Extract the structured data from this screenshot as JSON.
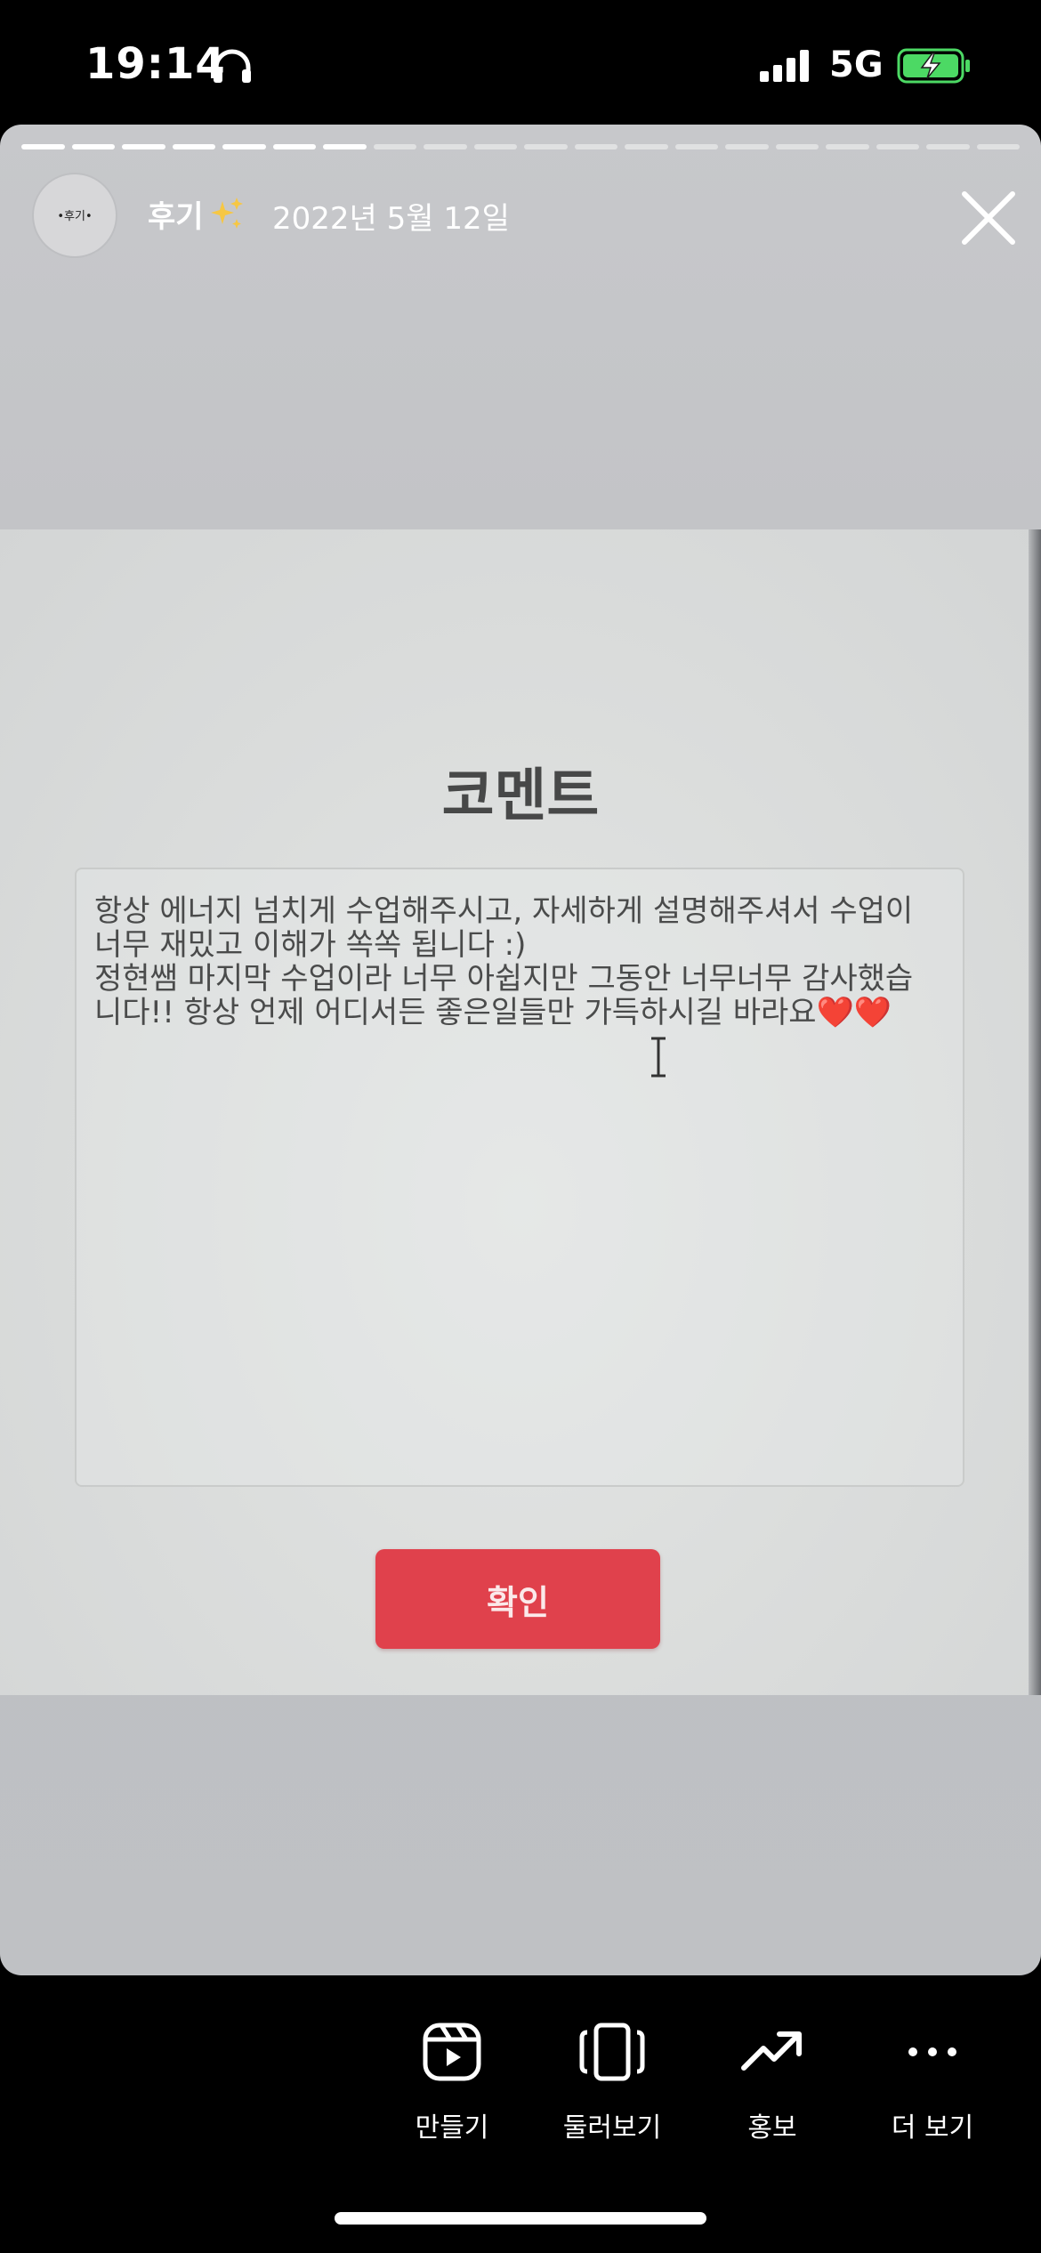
{
  "status_bar": {
    "time": "19:14",
    "network": "5G",
    "icons": [
      "headphones-icon",
      "signal-icon",
      "battery-charging-icon"
    ],
    "battery_color": "#4cd964"
  },
  "story": {
    "progress_total": 20,
    "progress_done": 7,
    "avatar_label": "•후기•",
    "username": "후기",
    "date": "2022년 5월 12일"
  },
  "photo": {
    "title": "코멘트",
    "comment": "항상 에너지 넘치게 수업해주시고, 자세하게 설명해주셔서 수업이\n너무 재밌고 이해가 쏙쏙 됩니다 :)\n정현쌤 마지막 수업이라 너무 아쉽지만 그동안 너무너무 감사했습\n니다!! 항상 언제 어디서든 좋은일들만 가득하시길 바라요❤️❤️",
    "confirm_label": "확인",
    "accent_color": "#e0414c"
  },
  "actions": [
    {
      "label": "만들기",
      "icon": "reels-create-icon"
    },
    {
      "label": "둘러보기",
      "icon": "browse-icon"
    },
    {
      "label": "홍보",
      "icon": "trending-up-icon"
    },
    {
      "label": "더 보기",
      "icon": "more-icon"
    }
  ]
}
